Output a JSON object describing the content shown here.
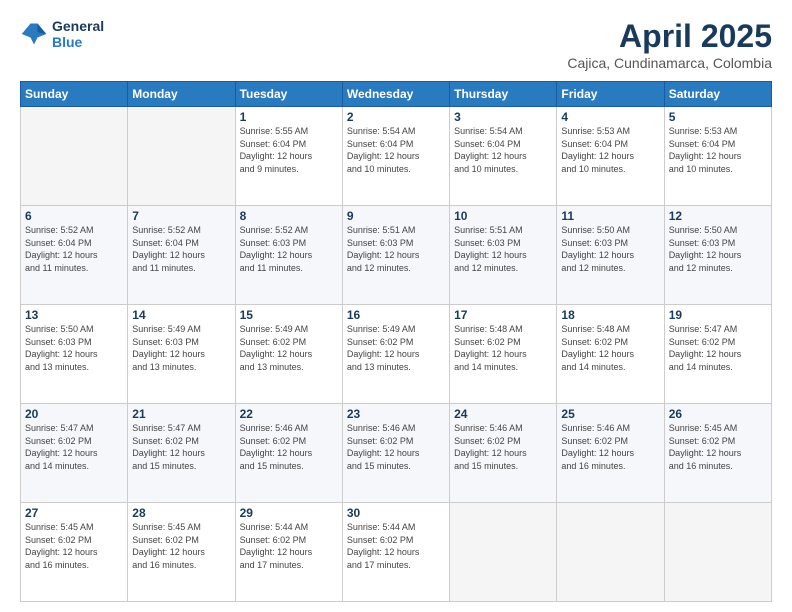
{
  "header": {
    "logo": {
      "line1": "General",
      "line2": "Blue"
    },
    "title": "April 2025",
    "location": "Cajica, Cundinamarca, Colombia"
  },
  "weekdays": [
    "Sunday",
    "Monday",
    "Tuesday",
    "Wednesday",
    "Thursday",
    "Friday",
    "Saturday"
  ],
  "weeks": [
    [
      {
        "day": "",
        "info": ""
      },
      {
        "day": "",
        "info": ""
      },
      {
        "day": "1",
        "info": "Sunrise: 5:55 AM\nSunset: 6:04 PM\nDaylight: 12 hours\nand 9 minutes."
      },
      {
        "day": "2",
        "info": "Sunrise: 5:54 AM\nSunset: 6:04 PM\nDaylight: 12 hours\nand 10 minutes."
      },
      {
        "day": "3",
        "info": "Sunrise: 5:54 AM\nSunset: 6:04 PM\nDaylight: 12 hours\nand 10 minutes."
      },
      {
        "day": "4",
        "info": "Sunrise: 5:53 AM\nSunset: 6:04 PM\nDaylight: 12 hours\nand 10 minutes."
      },
      {
        "day": "5",
        "info": "Sunrise: 5:53 AM\nSunset: 6:04 PM\nDaylight: 12 hours\nand 10 minutes."
      }
    ],
    [
      {
        "day": "6",
        "info": "Sunrise: 5:52 AM\nSunset: 6:04 PM\nDaylight: 12 hours\nand 11 minutes."
      },
      {
        "day": "7",
        "info": "Sunrise: 5:52 AM\nSunset: 6:04 PM\nDaylight: 12 hours\nand 11 minutes."
      },
      {
        "day": "8",
        "info": "Sunrise: 5:52 AM\nSunset: 6:03 PM\nDaylight: 12 hours\nand 11 minutes."
      },
      {
        "day": "9",
        "info": "Sunrise: 5:51 AM\nSunset: 6:03 PM\nDaylight: 12 hours\nand 12 minutes."
      },
      {
        "day": "10",
        "info": "Sunrise: 5:51 AM\nSunset: 6:03 PM\nDaylight: 12 hours\nand 12 minutes."
      },
      {
        "day": "11",
        "info": "Sunrise: 5:50 AM\nSunset: 6:03 PM\nDaylight: 12 hours\nand 12 minutes."
      },
      {
        "day": "12",
        "info": "Sunrise: 5:50 AM\nSunset: 6:03 PM\nDaylight: 12 hours\nand 12 minutes."
      }
    ],
    [
      {
        "day": "13",
        "info": "Sunrise: 5:50 AM\nSunset: 6:03 PM\nDaylight: 12 hours\nand 13 minutes."
      },
      {
        "day": "14",
        "info": "Sunrise: 5:49 AM\nSunset: 6:03 PM\nDaylight: 12 hours\nand 13 minutes."
      },
      {
        "day": "15",
        "info": "Sunrise: 5:49 AM\nSunset: 6:02 PM\nDaylight: 12 hours\nand 13 minutes."
      },
      {
        "day": "16",
        "info": "Sunrise: 5:49 AM\nSunset: 6:02 PM\nDaylight: 12 hours\nand 13 minutes."
      },
      {
        "day": "17",
        "info": "Sunrise: 5:48 AM\nSunset: 6:02 PM\nDaylight: 12 hours\nand 14 minutes."
      },
      {
        "day": "18",
        "info": "Sunrise: 5:48 AM\nSunset: 6:02 PM\nDaylight: 12 hours\nand 14 minutes."
      },
      {
        "day": "19",
        "info": "Sunrise: 5:47 AM\nSunset: 6:02 PM\nDaylight: 12 hours\nand 14 minutes."
      }
    ],
    [
      {
        "day": "20",
        "info": "Sunrise: 5:47 AM\nSunset: 6:02 PM\nDaylight: 12 hours\nand 14 minutes."
      },
      {
        "day": "21",
        "info": "Sunrise: 5:47 AM\nSunset: 6:02 PM\nDaylight: 12 hours\nand 15 minutes."
      },
      {
        "day": "22",
        "info": "Sunrise: 5:46 AM\nSunset: 6:02 PM\nDaylight: 12 hours\nand 15 minutes."
      },
      {
        "day": "23",
        "info": "Sunrise: 5:46 AM\nSunset: 6:02 PM\nDaylight: 12 hours\nand 15 minutes."
      },
      {
        "day": "24",
        "info": "Sunrise: 5:46 AM\nSunset: 6:02 PM\nDaylight: 12 hours\nand 15 minutes."
      },
      {
        "day": "25",
        "info": "Sunrise: 5:46 AM\nSunset: 6:02 PM\nDaylight: 12 hours\nand 16 minutes."
      },
      {
        "day": "26",
        "info": "Sunrise: 5:45 AM\nSunset: 6:02 PM\nDaylight: 12 hours\nand 16 minutes."
      }
    ],
    [
      {
        "day": "27",
        "info": "Sunrise: 5:45 AM\nSunset: 6:02 PM\nDaylight: 12 hours\nand 16 minutes."
      },
      {
        "day": "28",
        "info": "Sunrise: 5:45 AM\nSunset: 6:02 PM\nDaylight: 12 hours\nand 16 minutes."
      },
      {
        "day": "29",
        "info": "Sunrise: 5:44 AM\nSunset: 6:02 PM\nDaylight: 12 hours\nand 17 minutes."
      },
      {
        "day": "30",
        "info": "Sunrise: 5:44 AM\nSunset: 6:02 PM\nDaylight: 12 hours\nand 17 minutes."
      },
      {
        "day": "",
        "info": ""
      },
      {
        "day": "",
        "info": ""
      },
      {
        "day": "",
        "info": ""
      }
    ]
  ]
}
